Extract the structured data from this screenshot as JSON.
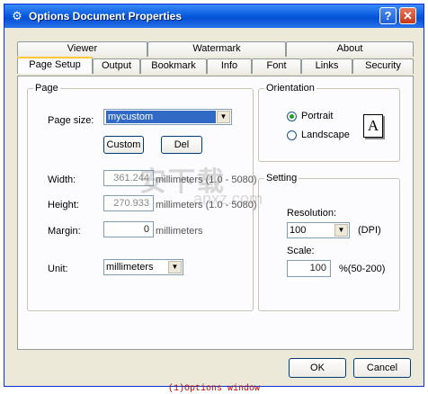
{
  "window": {
    "title": "Options Document Properties",
    "help_glyph": "?",
    "close_glyph": "✕",
    "title_icon": "gear-icon",
    "title_glyph": "⚙"
  },
  "tabs_top": [
    "Viewer",
    "Watermark",
    "About"
  ],
  "tabs_bottom": [
    "Page Setup",
    "Output",
    "Bookmark",
    "Info",
    "Font",
    "Links",
    "Security"
  ],
  "active_tab": "Page Setup",
  "page": {
    "legend": "Page",
    "page_size_label": "Page size:",
    "page_size_value": "mycustom",
    "custom_button": "Custom",
    "del_button": "Del",
    "width_label": "Width:",
    "width_value": "361.244",
    "width_unit": "millimeters (1.0 - 5080)",
    "height_label": "Height:",
    "height_value": "270.933",
    "height_unit": "millimeters (1.0 - 5080)",
    "margin_label": "Margin:",
    "margin_value": "0",
    "margin_unit": "millimeters",
    "unit_label": "Unit:",
    "unit_value": "millimeters"
  },
  "orientation": {
    "legend": "Orientation",
    "portrait": "Portrait",
    "landscape": "Landscape",
    "selected": "Portrait",
    "page_glyph": "A"
  },
  "setting": {
    "legend": "Setting",
    "resolution_label": "Resolution:",
    "resolution_value": "100",
    "resolution_unit": "(DPI)",
    "scale_label": "Scale:",
    "scale_value": "100",
    "scale_unit": "%(50-200)"
  },
  "buttons": {
    "ok": "OK",
    "cancel": "Cancel"
  },
  "watermark": {
    "text": "安下载",
    "sub": "anxz.com"
  },
  "caption": "(1)Options window",
  "colors": {
    "title_bar": "#0a5de0",
    "selection": "#316ac5",
    "dialog_bg": "#ece9d8"
  }
}
